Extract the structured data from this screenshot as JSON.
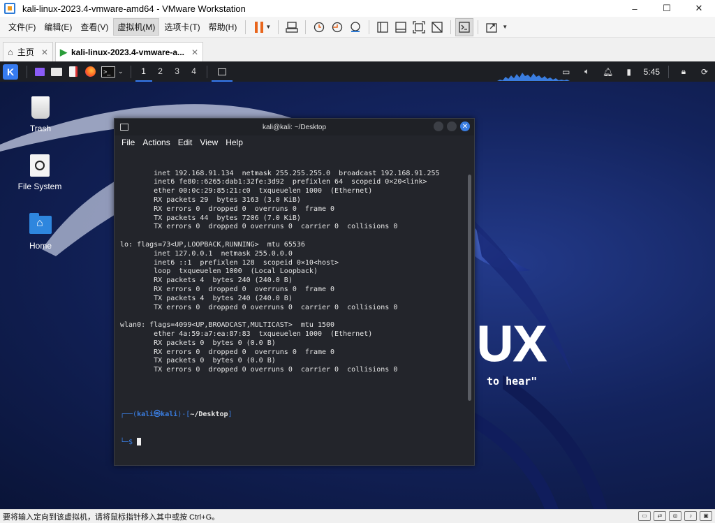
{
  "window": {
    "title": "kali-linux-2023.4-vmware-amd64 - VMware Workstation",
    "minimize": "–",
    "maximize": "☐",
    "close": "✕"
  },
  "menu": {
    "items": [
      "文件(F)",
      "编辑(E)",
      "查看(V)",
      "虚拟机(M)",
      "选项卡(T)",
      "帮助(H)"
    ]
  },
  "tabs": [
    {
      "label": "主页",
      "close": "✕"
    },
    {
      "label": "kali-linux-2023.4-vmware-a...",
      "close": "✕"
    }
  ],
  "kali_panel": {
    "workspaces": [
      "1",
      "2",
      "3",
      "4"
    ],
    "clock": "5:45"
  },
  "desktop_icons": [
    {
      "label": "Trash"
    },
    {
      "label": "File System"
    },
    {
      "label": "Home"
    }
  ],
  "terminal": {
    "title": "kali@kali: ~/Desktop",
    "menu": [
      "File",
      "Actions",
      "Edit",
      "View",
      "Help"
    ],
    "lines": [
      "        inet 192.168.91.134  netmask 255.255.255.0  broadcast 192.168.91.255",
      "        inet6 fe80::6265:dab1:32fe:3d92  prefixlen 64  scopeid 0×20<link>",
      "        ether 00:0c:29:85:21:c0  txqueuelen 1000  (Ethernet)",
      "        RX packets 29  bytes 3163 (3.0 KiB)",
      "        RX errors 0  dropped 0  overruns 0  frame 0",
      "        TX packets 44  bytes 7206 (7.0 KiB)",
      "        TX errors 0  dropped 0 overruns 0  carrier 0  collisions 0",
      "",
      "lo: flags=73<UP,LOOPBACK,RUNNING>  mtu 65536",
      "        inet 127.0.0.1  netmask 255.0.0.0",
      "        inet6 ::1  prefixlen 128  scopeid 0×10<host>",
      "        loop  txqueuelen 1000  (Local Loopback)",
      "        RX packets 4  bytes 240 (240.0 B)",
      "        RX errors 0  dropped 0  overruns 0  frame 0",
      "        TX packets 4  bytes 240 (240.0 B)",
      "        TX errors 0  dropped 0 overruns 0  carrier 0  collisions 0",
      "",
      "wlan0: flags=4099<UP,BROADCAST,MULTICAST>  mtu 1500",
      "        ether 4a:59:a7:ea:87:83  txqueuelen 1000  (Ethernet)",
      "        RX packets 0  bytes 0 (0.0 B)",
      "        RX errors 0  dropped 0  overruns 0  frame 0",
      "        TX packets 0  bytes 0 (0.0 B)",
      "        TX errors 0  dropped 0 overruns 0  carrier 0  collisions 0",
      "",
      ""
    ],
    "prompt": {
      "open": "┌──(",
      "user": "kali㉿kali",
      "mid": ")-[",
      "path": "~/Desktop",
      "close": "]",
      "line2": "└─$ "
    }
  },
  "wallpaper": {
    "logo_text": "KALI LINUX",
    "tagline": "\"the quieter you become, the more you are able to hear\""
  },
  "statusbar": {
    "text": "要将输入定向到该虚拟机，请将鼠标指针移入其中或按 Ctrl+G。"
  },
  "colors": {
    "accent": "#367bf0",
    "pause": "#e8651c"
  }
}
